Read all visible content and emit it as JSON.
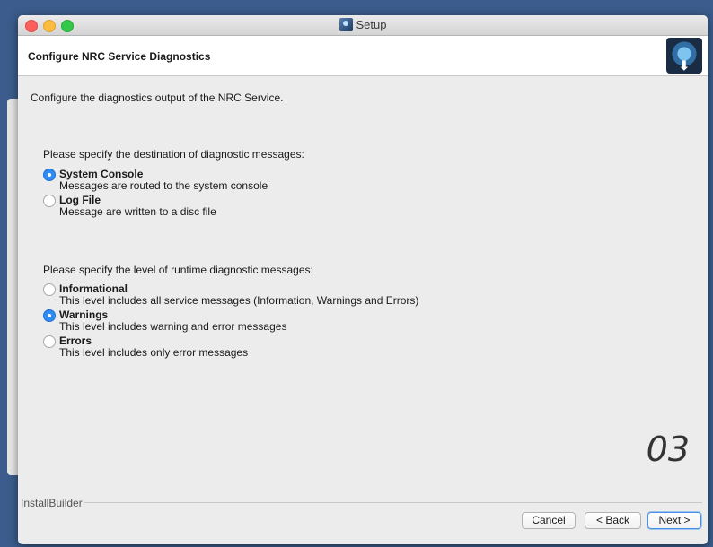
{
  "window": {
    "title": "Setup"
  },
  "header": {
    "title": "Configure NRC Service Diagnostics"
  },
  "intro": "Configure the diagnostics output of the NRC Service.",
  "destination": {
    "question": "Please specify the destination of diagnostic messages:",
    "options": [
      {
        "label": "System Console",
        "description": "Messages are routed to the system console",
        "selected": true
      },
      {
        "label": "Log File",
        "description": "Message are written to a disc file",
        "selected": false
      }
    ]
  },
  "level": {
    "question": "Please specify the level of runtime diagnostic messages:",
    "options": [
      {
        "label": "Informational",
        "description": "This level includes all service messages (Information, Warnings and Errors)",
        "selected": false
      },
      {
        "label": "Warnings",
        "description": "This level includes warning and error messages",
        "selected": true
      },
      {
        "label": "Errors",
        "description": "This level includes only error messages",
        "selected": false
      }
    ]
  },
  "page_number": "03",
  "footer": {
    "brand": "InstallBuilder",
    "cancel_label": "Cancel",
    "back_label": "< Back",
    "next_label": "Next >"
  },
  "colors": {
    "radio_selected": "#2f8cf6",
    "desktop": "#3b5c8c"
  },
  "icons": {
    "app": "setup-app-icon",
    "logo": "installbuilder-gear-download-icon"
  }
}
